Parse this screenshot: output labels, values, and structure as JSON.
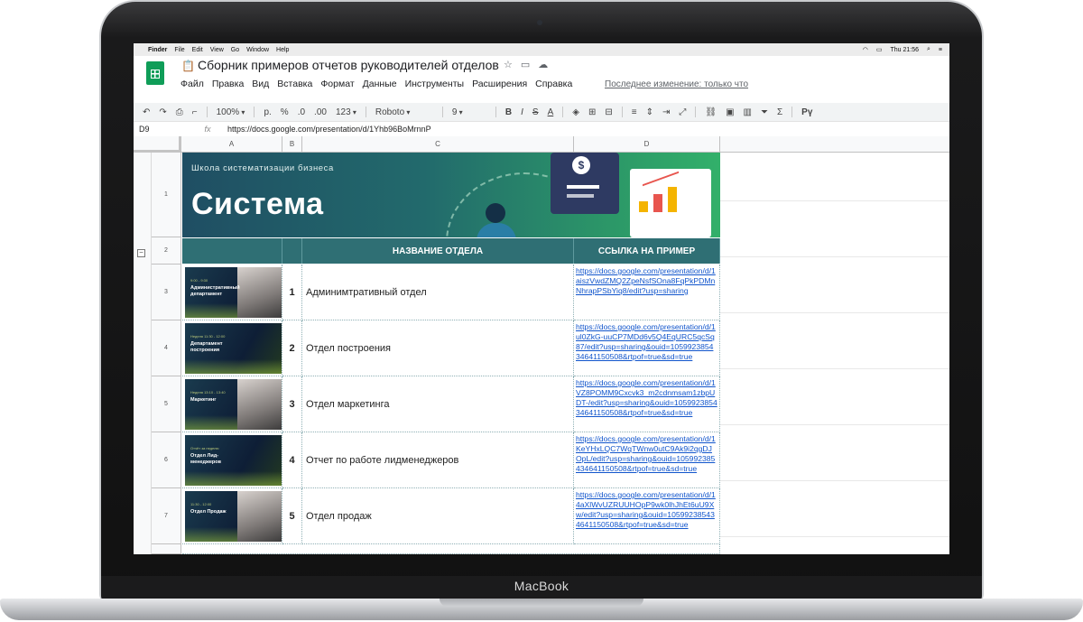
{
  "device": {
    "brand": "MacBook"
  },
  "menubar": {
    "app": "Finder",
    "items": [
      "File",
      "Edit",
      "View",
      "Go",
      "Window",
      "Help"
    ],
    "clock": "Thu 21:56"
  },
  "doc": {
    "title": "Сборник примеров отчетов руководителей отделов",
    "menus": [
      "Файл",
      "Правка",
      "Вид",
      "Вставка",
      "Формат",
      "Данные",
      "Инструменты",
      "Расширения",
      "Справка"
    ],
    "last_edit": "Последнее изменение: только что"
  },
  "toolbar": {
    "zoom": "100%",
    "currency": "р.",
    "percent": "%",
    "dec_less": ".0",
    "dec_more": ".00",
    "format": "123",
    "font": "Roboto",
    "size": "9"
  },
  "formula_bar": {
    "cell_ref": "D9",
    "fx": "fx",
    "value": "https://docs.google.com/presentation/d/1Yhb96BoMrnnP"
  },
  "columns": [
    "A",
    "B",
    "C",
    "D"
  ],
  "rows": [
    "1",
    "2",
    "3",
    "4",
    "5",
    "6",
    "7"
  ],
  "banner": {
    "subtitle": "Школа систематизации бизнеса",
    "title": "Система",
    "coin_symbol": "$"
  },
  "table_header": {
    "name": "НАЗВАНИЕ ОТДЕЛА",
    "link": "ССЫЛКА НА ПРИМЕР"
  },
  "table_rows": [
    {
      "num": "1",
      "name": "Админимтративный отдел",
      "thumb_small": "9:00 - 9:30",
      "thumb_title": "Административный департамент",
      "link": "https://docs.google.com/presentation/d/1aiszVwdZMQ2ZpeNsfSOna8FqPkPDMnNhrapPSbYiq8/edit?usp=sharing"
    },
    {
      "num": "2",
      "name": "Отдел построения",
      "thumb_small": "Неделя 11:30 - 12:00",
      "thumb_title": "Департамент построения",
      "link": "https://docs.google.com/presentation/d/1ul0ZkG-uuCP7MDd6v5Q4EqURC5qcSq87/edit?usp=sharing&ouid=105992385434641150508&rtpof=true&sd=true"
    },
    {
      "num": "3",
      "name": "Отдел маркетинга",
      "thumb_small": "Неделя 13:10 - 13:40",
      "thumb_title": "Маркетинг",
      "link": "https://docs.google.com/presentation/d/1VZ8POMM9Cxcvk3_m2cdnmsam1zbpUDT-/edit?usp=sharing&ouid=105992385434641150508&rtpof=true&sd=true"
    },
    {
      "num": "4",
      "name": "Отчет по работе лидменеджеров",
      "thumb_small": "Отчёт за неделю",
      "thumb_title": "Отдел Лид-менеджеров",
      "link": "https://docs.google.com/presentation/d/1KeYHxLQC7WqTWnw0utC9Ak9i2qgDJOpL/edit?usp=sharing&ouid=105992385434641150508&rtpof=true&sd=true"
    },
    {
      "num": "5",
      "name": "Отдел продаж",
      "thumb_small": "11:30 - 12:00",
      "thumb_title": "Отдел Продаж",
      "link": "https://docs.google.com/presentation/d/14aXlWvUZRUUHOpP9wk0lhJhEt6uU9Xw/edit?usp=sharing&ouid=105992385434641150508&rtpof=true&sd=true"
    }
  ]
}
